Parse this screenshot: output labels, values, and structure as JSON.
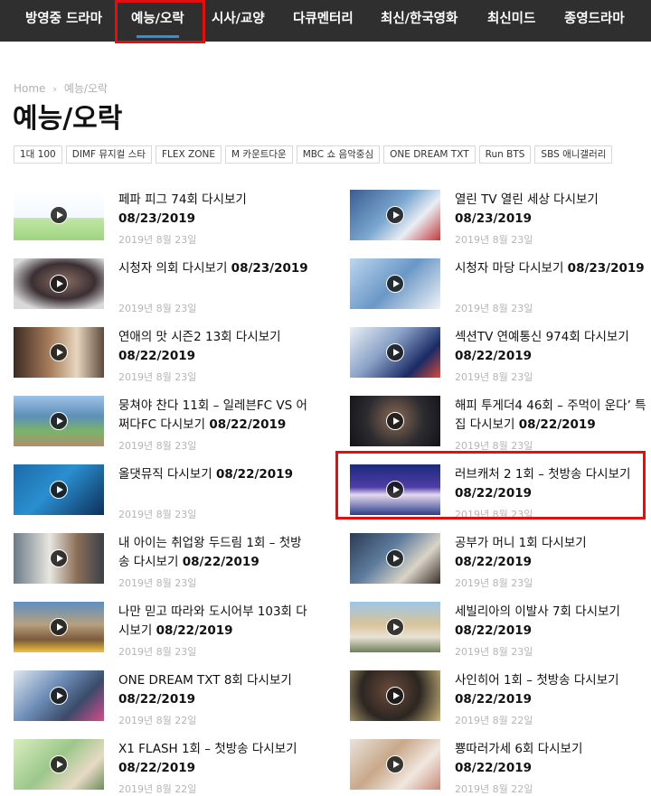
{
  "nav": {
    "items": [
      {
        "label": "방영중 드라마",
        "active": false
      },
      {
        "label": "예능/오락",
        "active": true
      },
      {
        "label": "시사/교양",
        "active": false
      },
      {
        "label": "다큐멘터리",
        "active": false
      },
      {
        "label": "최신/한국영화",
        "active": false
      },
      {
        "label": "최신미드",
        "active": false
      },
      {
        "label": "종영드라마",
        "active": false
      }
    ],
    "active_color": "#2f8fe0",
    "background": "#2f2f2f"
  },
  "breadcrumb": {
    "home": "Home",
    "current": "예능/오락"
  },
  "page_title": "예능/오락",
  "tags": [
    "1대 100",
    "DIMF 뮤지컬 스타",
    "FLEX ZONE",
    "M 카운트다운",
    "MBC 쇼 음악중심",
    "ONE DREAM TXT",
    "Run BTS",
    "SBS 애니갤러리"
  ],
  "posts": [
    {
      "title": "페파 피그 74회 다시보기",
      "date_line": "08/23/2019",
      "published": "2019년 8월 23일",
      "thumb": "peppa"
    },
    {
      "title": "열린 TV 열린 세상 다시보기",
      "date_line": "08/23/2019",
      "published": "2019년 8월 23일",
      "thumb": "studio"
    },
    {
      "title": "시청자 의회 다시보기",
      "date_line": "08/23/2019",
      "published": "2019년 8월 23일",
      "thumb": "tvset"
    },
    {
      "title": "시청자 마당 다시보기",
      "date_line": "08/23/2019",
      "published": "2019년 8월 23일",
      "thumb": "panel"
    },
    {
      "title": "연애의 맛 시즌2 13회 다시보기",
      "date_line": "08/22/2019",
      "published": "2019년 8월 23일",
      "thumb": "dating"
    },
    {
      "title": "섹션TV 연예통신 974회 다시보기",
      "date_line": "08/22/2019",
      "published": "2019년 8월 23일",
      "thumb": "section"
    },
    {
      "title": "뭉쳐야 찬다 11회 – 일레븐FC VS 어쩌다FC 다시보기",
      "date_line": "08/22/2019",
      "published": "2019년 8월 23일",
      "thumb": "soccer"
    },
    {
      "title": "해피 투게더4 46회 – 주먹이 운다’ 특집 다시보기",
      "date_line": "08/22/2019",
      "published": "2019년 8월 23일",
      "thumb": "fighter"
    },
    {
      "title": "올댓뮤직 다시보기",
      "date_line": "08/22/2019",
      "published": "2019년 8월 23일",
      "thumb": "music"
    },
    {
      "title": "러브캐처 2 1회 – 첫방송 다시보기",
      "date_line": "08/22/2019",
      "published": "2019년 8월 23일",
      "thumb": "lovecatcher"
    },
    {
      "title": "내 아이는 취업왕 두드림 1회 – 첫방송 다시보기",
      "date_line": "08/22/2019",
      "published": "2019년 8월 23일",
      "thumb": "chef"
    },
    {
      "title": "공부가 머니 1회 다시보기",
      "date_line": "08/22/2019",
      "published": "2019년 8월 23일",
      "thumb": "study"
    },
    {
      "title": "나만 믿고 따라와 도시어부 103회 다시보기",
      "date_line": "08/22/2019",
      "published": "2019년 8월 23일",
      "thumb": "fishing"
    },
    {
      "title": "세빌리아의 이발사 7회 다시보기",
      "date_line": "08/22/2019",
      "published": "2019년 8월 23일",
      "thumb": "barber"
    },
    {
      "title": "ONE DREAM TXT 8회 다시보기",
      "date_line": "08/22/2019",
      "published": "2019년 8월 22일",
      "thumb": "txt"
    },
    {
      "title": "사인히어 1회 – 첫방송 다시보기",
      "date_line": "08/22/2019",
      "published": "2019년 8월 22일",
      "thumb": "signhere"
    },
    {
      "title": "X1 FLASH 1회 – 첫방송 다시보기",
      "date_line": "08/22/2019",
      "published": "2019년 8월 22일",
      "thumb": "x1"
    },
    {
      "title": "뿅따러가세 6회 다시보기",
      "date_line": "08/22/2019",
      "published": "2019년 8월 22일",
      "thumb": "ppong"
    }
  ]
}
